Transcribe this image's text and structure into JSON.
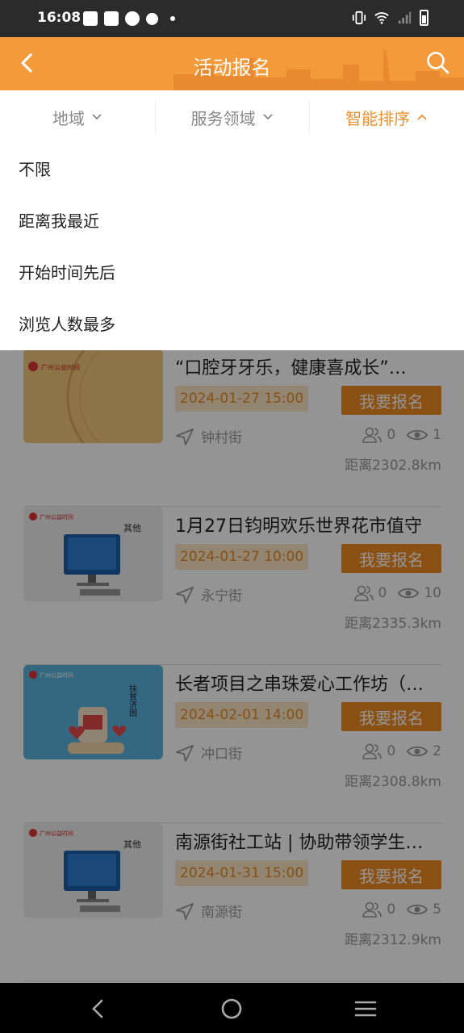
{
  "status_bar": {
    "time": "16:08",
    "icons": [
      "mail-icon",
      "mail-icon",
      "check-circle-icon",
      "shield-x-icon",
      "dot-icon",
      "vibrate-icon",
      "wifi-icon",
      "signal-icon",
      "battery-icon"
    ]
  },
  "header": {
    "title": "活动报名",
    "back_icon": "chevron-left-icon",
    "search_icon": "search-icon",
    "color": "#f39a3a"
  },
  "filters": {
    "tabs": [
      {
        "label": "地域",
        "active": false
      },
      {
        "label": "服务领域",
        "active": false
      },
      {
        "label": "智能排序",
        "active": true
      }
    ],
    "active_color": "#ef8f2d"
  },
  "sort_options": [
    "不限",
    "距离我最近",
    "开始时间先后",
    "浏览人数最多"
  ],
  "activities": [
    {
      "title": "“口腔牙牙乐，健康喜成长”…",
      "date": "2024-01-27 15:00",
      "button": "我要报名",
      "street": "钟村街",
      "signups": "0",
      "views": "1",
      "distance": "距离2302.8km",
      "thumb_banner": "广州公益时间"
    },
    {
      "title": "1月27日钧明欢乐世界花市值守",
      "date": "2024-01-27 10:00",
      "button": "我要报名",
      "street": "永宁街",
      "signups": "0",
      "views": "10",
      "distance": "距离2335.3km",
      "thumb_banner": "广州公益时间",
      "thumb_tag": "其他"
    },
    {
      "title": "长者项目之串珠爱心工作坊（…",
      "date": "2024-02-01 14:00",
      "button": "我要报名",
      "street": "冲口街",
      "signups": "0",
      "views": "2",
      "distance": "距离2308.8km",
      "thumb_banner": "广州公益时间",
      "thumb_tag": "扶贫济困"
    },
    {
      "title": "南源街社工站 | 协助带领学生…",
      "date": "2024-01-31 15:00",
      "button": "我要报名",
      "street": "南源街",
      "signups": "0",
      "views": "5",
      "distance": "距离2312.9km",
      "thumb_banner": "广州公益时间",
      "thumb_tag": "其他"
    }
  ],
  "nav_bar": {
    "icons": [
      "back-nav-icon",
      "home-nav-icon",
      "recents-nav-icon"
    ]
  }
}
